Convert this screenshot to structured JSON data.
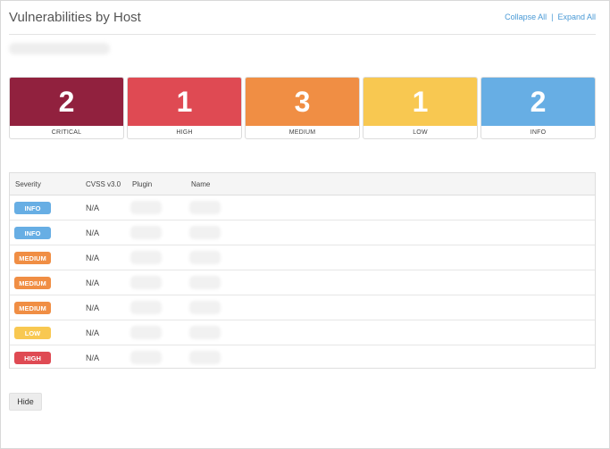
{
  "header": {
    "title": "Vulnerabilities by Host",
    "collapse_all": "Collapse All",
    "separator": "|",
    "expand_all": "Expand All"
  },
  "summary": [
    {
      "count": "2",
      "label": "CRITICAL",
      "color": "#91213e"
    },
    {
      "count": "1",
      "label": "HIGH",
      "color": "#df4a53"
    },
    {
      "count": "3",
      "label": "MEDIUM",
      "color": "#f08e44"
    },
    {
      "count": "1",
      "label": "LOW",
      "color": "#f8c851"
    },
    {
      "count": "2",
      "label": "INFO",
      "color": "#67aee4"
    }
  ],
  "table": {
    "columns": [
      "Severity",
      "CVSS v3.0",
      "Plugin",
      "Name"
    ],
    "rows": [
      {
        "severity": "INFO",
        "cvss": "N/A"
      },
      {
        "severity": "INFO",
        "cvss": "N/A"
      },
      {
        "severity": "MEDIUM",
        "cvss": "N/A"
      },
      {
        "severity": "MEDIUM",
        "cvss": "N/A"
      },
      {
        "severity": "MEDIUM",
        "cvss": "N/A"
      },
      {
        "severity": "LOW",
        "cvss": "N/A"
      },
      {
        "severity": "HIGH",
        "cvss": "N/A"
      }
    ]
  },
  "severity_colors": {
    "CRITICAL": "#91213e",
    "HIGH": "#df4a53",
    "MEDIUM": "#f08e44",
    "LOW": "#f8c851",
    "INFO": "#67aee4"
  },
  "hide_button": "Hide"
}
